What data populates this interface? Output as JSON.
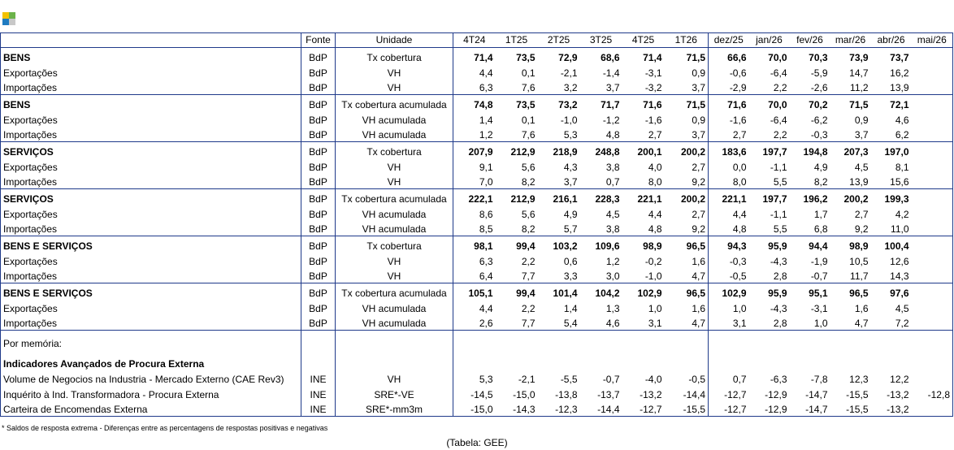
{
  "colors": {
    "border": "#1f3a8a",
    "logo": [
      "#f2c200",
      "#6bb34a",
      "#1e7bc1",
      "#c8c8c8"
    ]
  },
  "header": [
    "",
    "Fonte",
    "Unidade",
    "4T24",
    "1T25",
    "2T25",
    "3T25",
    "4T25",
    "1T26",
    "dez/25",
    "jan/26",
    "fev/26",
    "mar/26",
    "abr/26",
    "mai/26"
  ],
  "groups": [
    {
      "rows": [
        {
          "label": "BENS",
          "source": "BdP",
          "unit": "Tx cobertura",
          "bold": true,
          "values": [
            "71,4",
            "73,5",
            "72,9",
            "68,6",
            "71,4",
            "71,5",
            "66,6",
            "70,0",
            "70,3",
            "73,9",
            "73,7",
            ""
          ]
        },
        {
          "label": "Exportações",
          "source": "BdP",
          "unit": "VH",
          "values": [
            "4,4",
            "0,1",
            "-2,1",
            "-1,4",
            "-3,1",
            "0,9",
            "-0,6",
            "-6,4",
            "-5,9",
            "14,7",
            "16,2",
            ""
          ]
        },
        {
          "label": "Importações",
          "source": "BdP",
          "unit": "VH",
          "values": [
            "6,3",
            "7,6",
            "3,2",
            "3,7",
            "-3,2",
            "3,7",
            "-2,9",
            "2,2",
            "-2,6",
            "11,2",
            "13,9",
            ""
          ]
        }
      ]
    },
    {
      "rows": [
        {
          "label": "BENS",
          "source": "BdP",
          "unit": "Tx cobertura acumulada",
          "bold": true,
          "values": [
            "74,8",
            "73,5",
            "73,2",
            "71,7",
            "71,6",
            "71,5",
            "71,6",
            "70,0",
            "70,2",
            "71,5",
            "72,1",
            ""
          ]
        },
        {
          "label": "Exportações",
          "source": "BdP",
          "unit": "VH acumulada",
          "values": [
            "1,4",
            "0,1",
            "-1,0",
            "-1,2",
            "-1,6",
            "0,9",
            "-1,6",
            "-6,4",
            "-6,2",
            "0,9",
            "4,6",
            ""
          ]
        },
        {
          "label": "Importações",
          "source": "BdP",
          "unit": "VH acumulada",
          "values": [
            "1,2",
            "7,6",
            "5,3",
            "4,8",
            "2,7",
            "3,7",
            "2,7",
            "2,2",
            "-0,3",
            "3,7",
            "6,2",
            ""
          ]
        }
      ]
    },
    {
      "rows": [
        {
          "label": "SERVIÇOS",
          "source": "BdP",
          "unit": "Tx cobertura",
          "bold": true,
          "values": [
            "207,9",
            "212,9",
            "218,9",
            "248,8",
            "200,1",
            "200,2",
            "183,6",
            "197,7",
            "194,8",
            "207,3",
            "197,0",
            ""
          ]
        },
        {
          "label": "Exportações",
          "source": "BdP",
          "unit": "VH",
          "values": [
            "9,1",
            "5,6",
            "4,3",
            "3,8",
            "4,0",
            "2,7",
            "0,0",
            "-1,1",
            "4,9",
            "4,5",
            "8,1",
            ""
          ]
        },
        {
          "label": "Importações",
          "source": "BdP",
          "unit": "VH",
          "values": [
            "7,0",
            "8,2",
            "3,7",
            "0,7",
            "8,0",
            "9,2",
            "8,0",
            "5,5",
            "8,2",
            "13,9",
            "15,6",
            ""
          ]
        }
      ]
    },
    {
      "rows": [
        {
          "label": "SERVIÇOS",
          "source": "BdP",
          "unit": "Tx cobertura acumulada",
          "bold": true,
          "values": [
            "222,1",
            "212,9",
            "216,1",
            "228,3",
            "221,1",
            "200,2",
            "221,1",
            "197,7",
            "196,2",
            "200,2",
            "199,3",
            ""
          ]
        },
        {
          "label": "Exportações",
          "source": "BdP",
          "unit": "VH acumulada",
          "values": [
            "8,6",
            "5,6",
            "4,9",
            "4,5",
            "4,4",
            "2,7",
            "4,4",
            "-1,1",
            "1,7",
            "2,7",
            "4,2",
            ""
          ]
        },
        {
          "label": "Importações",
          "source": "BdP",
          "unit": "VH acumulada",
          "values": [
            "8,5",
            "8,2",
            "5,7",
            "3,8",
            "4,8",
            "9,2",
            "4,8",
            "5,5",
            "6,8",
            "9,2",
            "11,0",
            ""
          ]
        }
      ]
    },
    {
      "rows": [
        {
          "label": "BENS E SERVIÇOS",
          "source": "BdP",
          "unit": "Tx cobertura",
          "bold": true,
          "values": [
            "98,1",
            "99,4",
            "103,2",
            "109,6",
            "98,9",
            "96,5",
            "94,3",
            "95,9",
            "94,4",
            "98,9",
            "100,4",
            ""
          ]
        },
        {
          "label": "Exportações",
          "source": "BdP",
          "unit": "VH",
          "values": [
            "6,3",
            "2,2",
            "0,6",
            "1,2",
            "-0,2",
            "1,6",
            "-0,3",
            "-4,3",
            "-1,9",
            "10,5",
            "12,6",
            ""
          ]
        },
        {
          "label": "Importações",
          "source": "BdP",
          "unit": "VH",
          "values": [
            "6,4",
            "7,7",
            "3,3",
            "3,0",
            "-1,0",
            "4,7",
            "-0,5",
            "2,8",
            "-0,7",
            "11,7",
            "14,3",
            ""
          ]
        }
      ]
    },
    {
      "rows": [
        {
          "label": "BENS E SERVIÇOS",
          "source": "BdP",
          "unit": "Tx cobertura acumulada",
          "bold": true,
          "values": [
            "105,1",
            "99,4",
            "101,4",
            "104,2",
            "102,9",
            "96,5",
            "102,9",
            "95,9",
            "95,1",
            "96,5",
            "97,6",
            ""
          ]
        },
        {
          "label": "Exportações",
          "source": "BdP",
          "unit": "VH acumulada",
          "values": [
            "4,4",
            "2,2",
            "1,4",
            "1,3",
            "1,0",
            "1,6",
            "1,0",
            "-4,3",
            "-3,1",
            "1,6",
            "4,5",
            ""
          ]
        },
        {
          "label": "Importações",
          "source": "BdP",
          "unit": "VH acumulada",
          "values": [
            "2,6",
            "7,7",
            "5,4",
            "4,6",
            "3,1",
            "4,7",
            "3,1",
            "2,8",
            "1,0",
            "4,7",
            "7,2",
            ""
          ]
        }
      ]
    },
    {
      "rows": [
        {
          "label": "Por memória:",
          "source": "",
          "unit": "",
          "values": [
            "",
            "",
            "",
            "",
            "",
            "",
            "",
            "",
            "",
            "",
            "",
            ""
          ]
        },
        {
          "label": "Indicadores Avançados de Procura Externa",
          "source": "",
          "unit": "",
          "bold": true,
          "values": [
            "",
            "",
            "",
            "",
            "",
            "",
            "",
            "",
            "",
            "",
            "",
            ""
          ]
        },
        {
          "label": "Volume de Negocios na Industria - Mercado Externo (CAE Rev3)",
          "source": "INE",
          "unit": "VH",
          "values": [
            "5,3",
            "-2,1",
            "-5,5",
            "-0,7",
            "-4,0",
            "-0,5",
            "0,7",
            "-6,3",
            "-7,8",
            "12,3",
            "12,2",
            ""
          ]
        },
        {
          "label": "Inquérito à Ind. Transformadora - Procura Externa",
          "source": "INE",
          "unit": "SRE*-VE",
          "values": [
            "-14,5",
            "-15,0",
            "-13,8",
            "-13,7",
            "-13,2",
            "-14,4",
            "-12,7",
            "-12,9",
            "-14,7",
            "-15,5",
            "-13,2",
            "-12,8"
          ]
        },
        {
          "label": "Carteira de Encomendas Externa",
          "source": "INE",
          "unit": "SRE*-mm3m",
          "values": [
            "-15,0",
            "-14,3",
            "-12,3",
            "-14,4",
            "-12,7",
            "-15,5",
            "-12,7",
            "-12,9",
            "-14,7",
            "-15,5",
            "-13,2",
            ""
          ]
        }
      ]
    }
  ],
  "footnote": "* Saldos de resposta extrema - Diferenças entre as percentagens de respostas positivas e negativas",
  "source_line": "(Tabela: GEE)"
}
